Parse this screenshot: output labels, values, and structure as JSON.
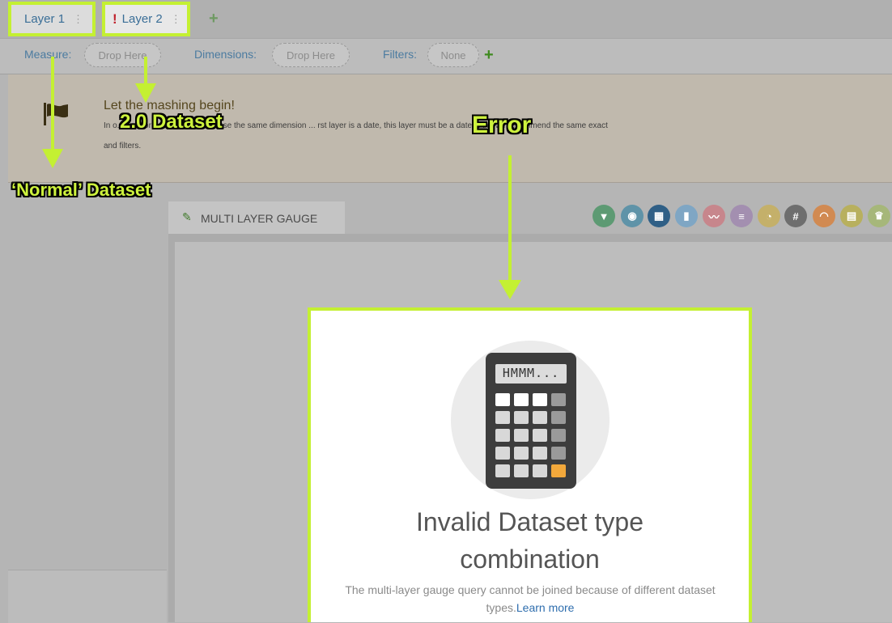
{
  "tabs": [
    {
      "label": "Layer 1",
      "kebab": "⋮"
    },
    {
      "label": "Layer 2",
      "kebab": "⋮",
      "alert": "!"
    }
  ],
  "add_tab": "+",
  "query": {
    "measure_label": "Measure:",
    "measure_placeholder": "Drop Here",
    "dimensions_label": "Dimensions:",
    "dimensions_placeholder": "Drop Here",
    "filters_label": "Filters:",
    "filters_value": "None",
    "add_filter": "+"
  },
  "notice": {
    "title": "Let the mashing begin!",
    "body": "In o... der correctly, you have to use the same dimension ... rst layer is a date, this layer must be a date). And we recommend the same exact",
    "body2": "and filters."
  },
  "widget": {
    "tab_label": "MULTI LAYER GAUGE",
    "toolbar_icons": [
      "funnel-icon",
      "camera-icon",
      "calculator-icon",
      "bar-chart-icon",
      "wave-icon",
      "list-icon",
      "pie-icon",
      "hash-icon",
      "gauge-icon",
      "panel-icon",
      "trophy-icon"
    ]
  },
  "error": {
    "screen_text": "HMMM...",
    "title_line1": "Invalid Dataset type",
    "title_line2": "combination",
    "message": "The multi-layer gauge query cannot be joined because of different dataset types.",
    "link": "Learn more"
  },
  "annotations": {
    "dataset2": "2.0 Dataset",
    "error": "Error",
    "normal": "‘Normal’ Dataset"
  },
  "colors": {
    "highlight": "#c4f032",
    "accent_blue": "#3a6e97",
    "alert_red": "#c0242f",
    "calculator_body": "#3d3d3d",
    "calculator_equals": "#f2a83b"
  }
}
